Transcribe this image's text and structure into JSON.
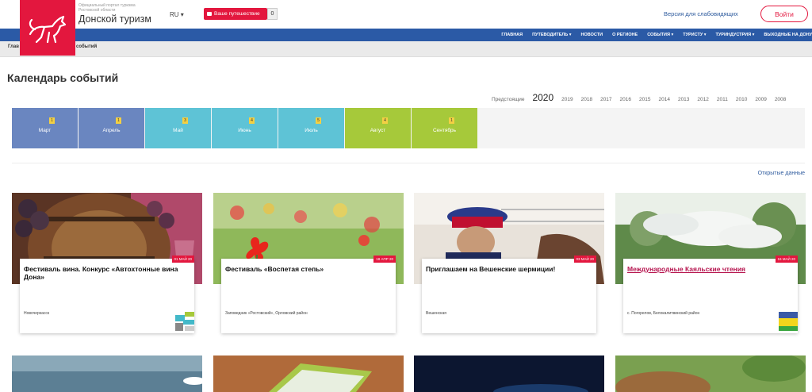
{
  "header": {
    "brand_small": "Официальный портал туризма Ростовской области",
    "brand_title": "Донской туризм",
    "lang": "RU ▾",
    "trip_label": "Ваше путешествие",
    "trip_count": "0",
    "impaired_link": "Версия для слабовидящих",
    "login": "Войти"
  },
  "nav": {
    "items": [
      "ГЛАВНАЯ",
      "ПУТЕВОДИТЕЛЬ ▾",
      "НОВОСТИ",
      "О РЕГИОНЕ",
      "СОБЫТИЯ ▾",
      "ТУРИСТУ ▾",
      "ТУРИНДУСТРИЯ ▾",
      "ВЫХОДНЫЕ НА ДОНУ"
    ]
  },
  "breadcrumb": {
    "part1": "Глав",
    "part2": "событий"
  },
  "page_title": "Календарь событий",
  "years": {
    "upcoming": "Предстоящие",
    "current": "2020",
    "list": [
      "2019",
      "2018",
      "2017",
      "2016",
      "2015",
      "2014",
      "2013",
      "2012",
      "2011",
      "2010",
      "2009",
      "2008"
    ]
  },
  "months": [
    {
      "label": "Март",
      "count": "1",
      "color": "#6a86c0"
    },
    {
      "label": "Апрель",
      "count": "1",
      "color": "#6a86c0"
    },
    {
      "label": "Май",
      "count": "3",
      "color": "#5ec3d6"
    },
    {
      "label": "Июнь",
      "count": "4",
      "color": "#5ec3d6"
    },
    {
      "label": "Июль",
      "count": "5",
      "color": "#5ec3d6"
    },
    {
      "label": "Август",
      "count": "4",
      "color": "#a6c93a"
    },
    {
      "label": "Сентябрь",
      "count": "1",
      "color": "#a6c93a"
    }
  ],
  "open_data": "Открытые данные",
  "events": [
    {
      "date": "01 МАЙ 20",
      "title": "Фестиваль вина. Конкурс «Автохтонные вина Дона»",
      "place": "Новочеркасск"
    },
    {
      "date": "18 АПР 20",
      "title": "Фестиваль «Воспетая степь»",
      "place": "Заповедник «Ростовский», Орловский район"
    },
    {
      "date": "03 МАЙ 20",
      "title": "Приглашаем на Вешенские шермиции!",
      "place": "Вешенская"
    },
    {
      "date": "16 МАЙ 20",
      "title": "Международные Каяльские чтения",
      "place": "с. Погорелов, Белокалитвинский район"
    }
  ]
}
